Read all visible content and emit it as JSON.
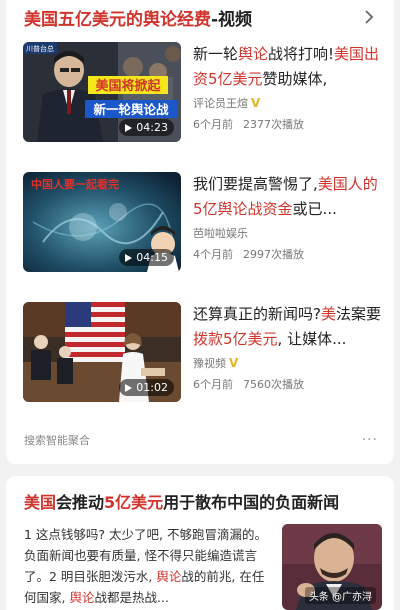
{
  "card1": {
    "title_red": "美国五亿美元的舆论经费",
    "title_rest": "-视频",
    "items": [
      {
        "title_segments": [
          {
            "t": "新一轮",
            "hl": false
          },
          {
            "t": "舆论",
            "hl": true
          },
          {
            "t": "战将打响!",
            "hl": false
          },
          {
            "t": "美国出资5亿美元",
            "hl": true
          },
          {
            "t": "赞助媒体,",
            "hl": false
          }
        ],
        "author": "评论员王煊",
        "verified": true,
        "time_ago": "6个月前",
        "plays": "2377次播放",
        "duration": "04:23",
        "thumb_text_1": "美国将掀起",
        "thumb_text_2": "新一轮舆论战",
        "thumb_corner": "川普台总"
      },
      {
        "title_segments": [
          {
            "t": "我们要提高警惕了,",
            "hl": false
          },
          {
            "t": "美国人的5亿舆论战资金",
            "hl": true
          },
          {
            "t": "或已...",
            "hl": false
          }
        ],
        "author": "芭啦啦娱乐",
        "verified": false,
        "time_ago": "4个月前",
        "plays": "2997次播放",
        "duration": "04:15",
        "thumb_text_1": "中国人要一起看完"
      },
      {
        "title_segments": [
          {
            "t": "还算真正的新闻吗?",
            "hl": false
          },
          {
            "t": "美",
            "hl": true
          },
          {
            "t": "法案要",
            "hl": false
          },
          {
            "t": "拨款5亿美元",
            "hl": true
          },
          {
            "t": ", 让媒体...",
            "hl": false
          }
        ],
        "author": "豫视频",
        "verified": true,
        "time_ago": "6个月前",
        "plays": "7560次播放",
        "duration": "01:02"
      }
    ],
    "footer_label": "搜索智能聚合",
    "more_label": "···"
  },
  "card2": {
    "title_segments": [
      {
        "t": "美国",
        "hl": true
      },
      {
        "t": "会推动",
        "hl": false
      },
      {
        "t": "5亿美元",
        "hl": true
      },
      {
        "t": "用于散布中国的负面新闻",
        "hl": false
      }
    ],
    "body_segments": [
      {
        "t": "1 这点钱够吗? 太少了吧, 不够跑冒滴漏的。负面新闻也要有质量, 怪不得只能编造谎言了。2 明目张胆泼污水, ",
        "hl": false
      },
      {
        "t": "舆论",
        "hl": true
      },
      {
        "t": "战的前兆, 在任何国家, ",
        "hl": false
      },
      {
        "t": "舆论",
        "hl": true
      },
      {
        "t": "战都是热战...",
        "hl": false
      }
    ],
    "watermark": "头条 @广亦浔"
  },
  "colors": {
    "highlight": "#d0342c",
    "verified": "#e6b422"
  },
  "icons": {
    "more": "chevron-right-icon",
    "play": "play-icon"
  }
}
